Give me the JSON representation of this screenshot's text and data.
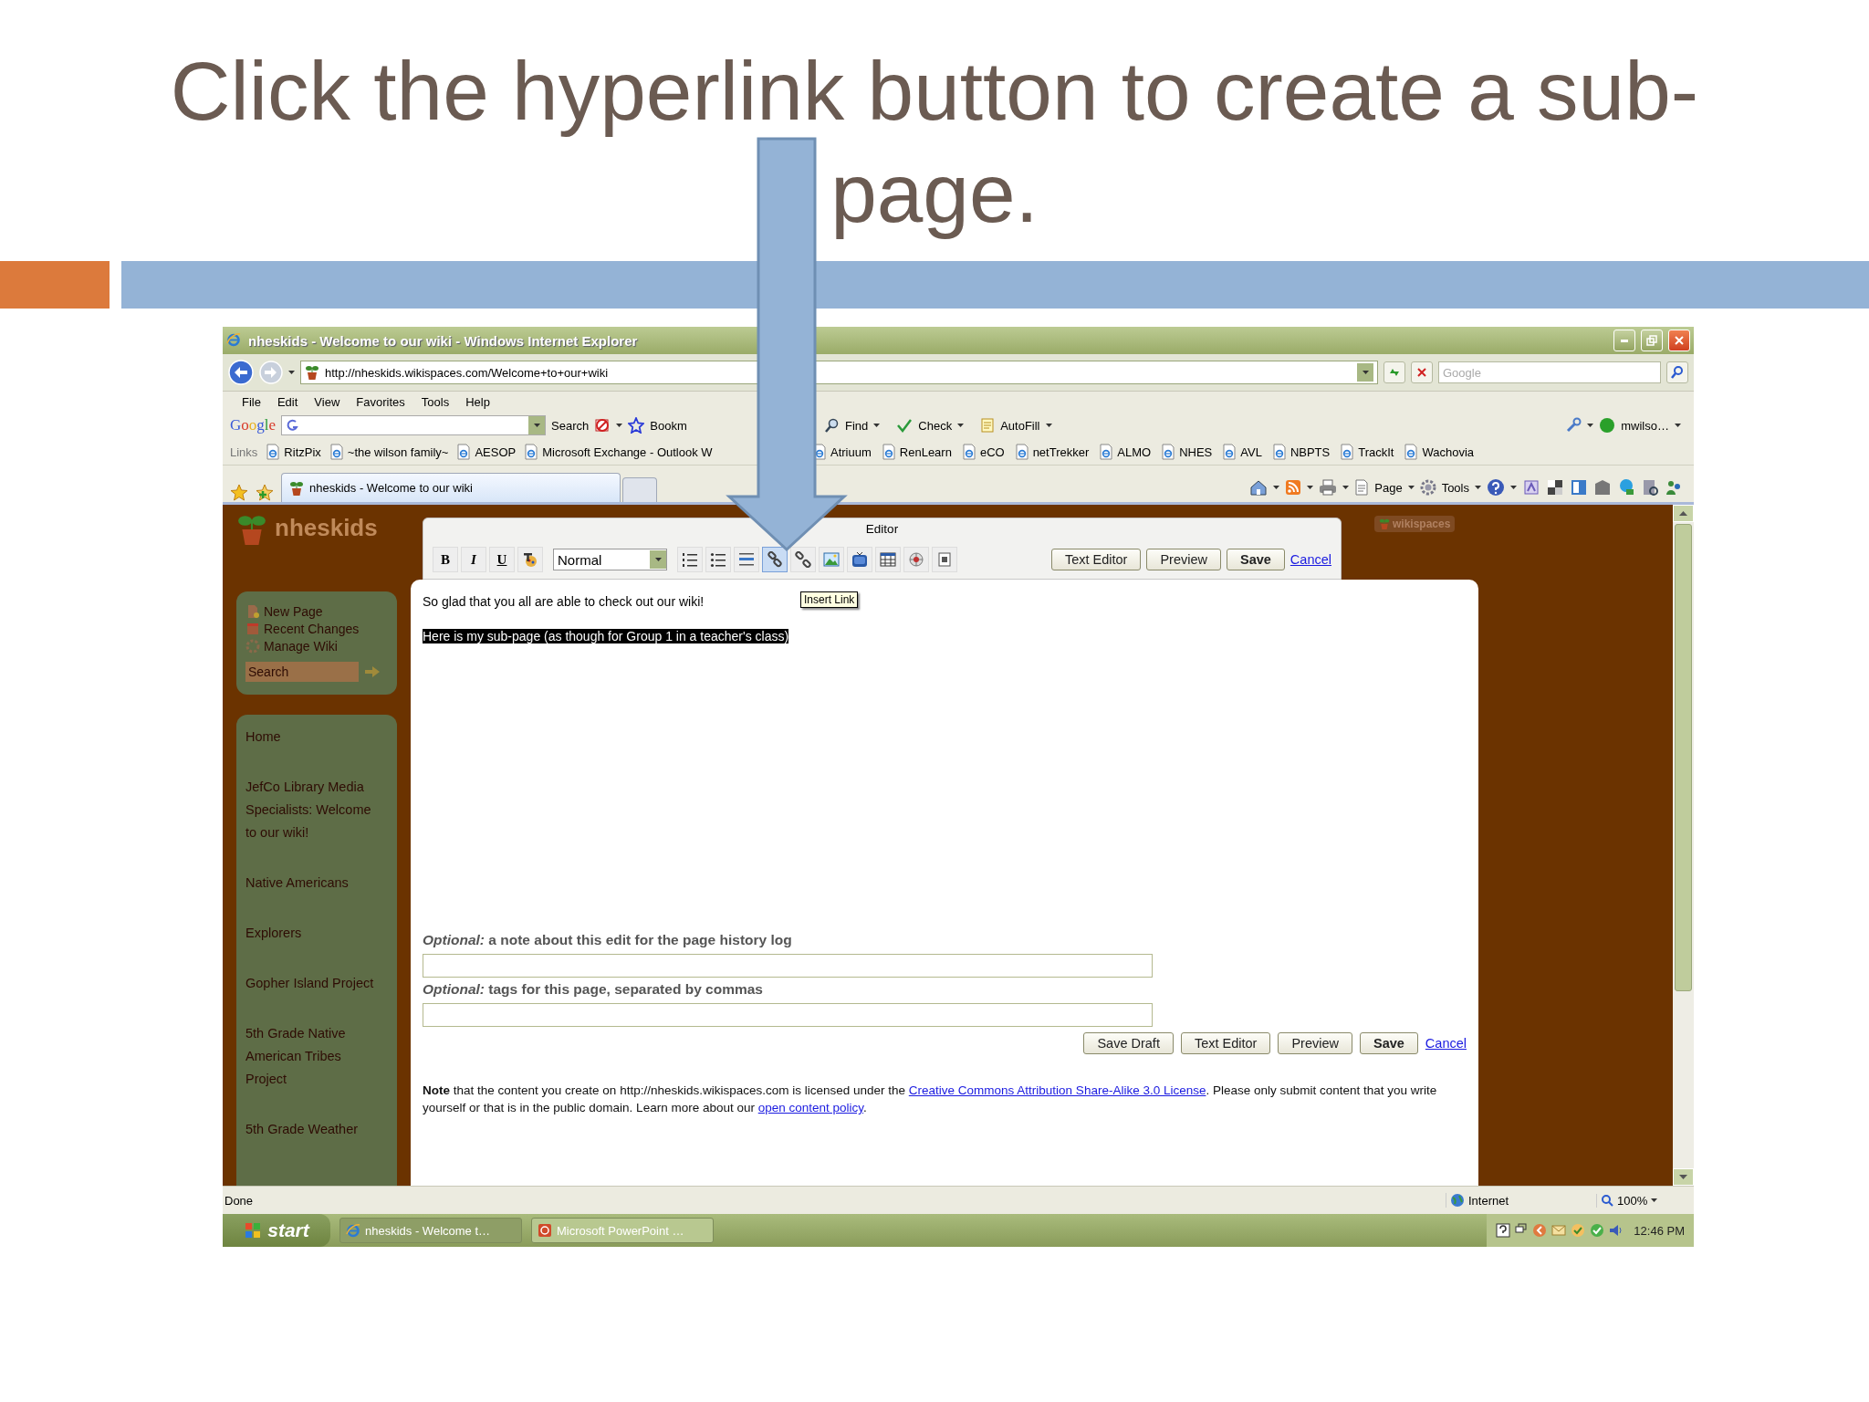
{
  "slide": {
    "title": "Click the hyperlink button to create a sub-page."
  },
  "window": {
    "title": "nheskids - Welcome to our wiki - Windows Internet Explorer"
  },
  "address_bar": {
    "url": "http://nheskids.wikispaces.com/Welcome+to+our+wiki"
  },
  "search_box": {
    "placeholder": "Google"
  },
  "menu": [
    "File",
    "Edit",
    "View",
    "Favorites",
    "Tools",
    "Help"
  ],
  "google_toolbar": {
    "logo": "Google",
    "search_label": "Search",
    "bookmarks_label": "Bookm",
    "items": [
      "Find",
      "Check",
      "AutoFill"
    ],
    "account": "mwilso…"
  },
  "links_bar": {
    "label": "Links",
    "items": [
      "RitzPix",
      "~the wilson family~",
      "AESOP",
      "Microsoft Exchange - Outlook W",
      "Atriuum",
      "RenLearn",
      "eCO",
      "netTrekker",
      "ALMO",
      "NHES",
      "AVL",
      "NBPTS",
      "TrackIt",
      "Wachovia"
    ]
  },
  "tabs": [
    {
      "label": "nheskids - Welcome to our wiki",
      "selected": true
    }
  ],
  "command_bar": [
    "Page",
    "Tools"
  ],
  "wiki": {
    "site_name": "nheskids",
    "badge": "wikispaces",
    "actions": [
      "New Page",
      "Recent Changes",
      "Manage Wiki"
    ],
    "search": {
      "placeholder": "Search"
    },
    "nav": [
      "Home",
      "JefCo Library Media Specialists: Welcome to our wiki!",
      "Native Americans",
      "Explorers",
      "Gopher Island Project",
      "5th Grade Native American Tribes Project",
      "5th Grade Weather"
    ]
  },
  "editor": {
    "title": "Editor",
    "tooltip": "Insert Link",
    "tools": [
      {
        "kind": "bold",
        "label": "B",
        "highlighted": false
      },
      {
        "kind": "italic",
        "label": "I",
        "highlighted": false
      },
      {
        "kind": "underline",
        "label": "U",
        "highlighted": false
      },
      {
        "kind": "color",
        "highlighted": false
      },
      {
        "kind": "select",
        "label": "Normal",
        "highlighted": false
      },
      {
        "kind": "numbered-list",
        "highlighted": false
      },
      {
        "kind": "bullet-list",
        "highlighted": false
      },
      {
        "kind": "rule",
        "highlighted": false
      },
      {
        "kind": "link",
        "highlighted": true
      },
      {
        "kind": "unlink",
        "highlighted": false
      },
      {
        "kind": "image",
        "highlighted": false
      },
      {
        "kind": "media",
        "highlighted": false
      },
      {
        "kind": "table",
        "highlighted": false
      },
      {
        "kind": "widget",
        "highlighted": false
      },
      {
        "kind": "special",
        "highlighted": false
      }
    ],
    "buttons": [
      {
        "kind": "button",
        "label": "Text Editor"
      },
      {
        "kind": "button",
        "label": "Preview"
      },
      {
        "kind": "primary",
        "label": "Save"
      },
      {
        "kind": "link",
        "label": "Cancel"
      }
    ],
    "lines": [
      {
        "text": "So glad that you all are able to check out our wiki!",
        "selected": false
      },
      {
        "text": "Here is my sub-page (as though for Group 1 in a teacher's class)",
        "selected": true
      }
    ]
  },
  "form": {
    "fields": [
      {
        "label": "*Optional:* a note about this edit for the page history log"
      },
      {
        "label": "*Optional:* tags for this page, separated by commas"
      }
    ],
    "buttons": [
      {
        "kind": "button",
        "label": "Save Draft"
      },
      {
        "kind": "button",
        "label": "Text Editor"
      },
      {
        "kind": "button",
        "label": "Preview"
      },
      {
        "kind": "primary",
        "label": "Save"
      },
      {
        "kind": "link",
        "label": "Cancel"
      }
    ],
    "note": {
      "before": "**Note** that the content you create on http://nheskids.wikispaces.com is licensed under the ",
      "link": "Creative Commons Attribution Share-Alike 3.0 License",
      "middle": ". Please only submit content that you write yourself or that is in the public domain. Learn more about our ",
      "link2": "open content policy",
      "after": "."
    }
  },
  "status_bar": {
    "text": "Done",
    "zone": "Internet",
    "zoom": "100%"
  },
  "taskbar": {
    "start": "start",
    "tasks": [
      {
        "label": "nheskids - Welcome t…",
        "selected": true
      },
      {
        "label": "Microsoft PowerPoint …",
        "selected": false
      }
    ],
    "clock": "12:46 PM"
  }
}
